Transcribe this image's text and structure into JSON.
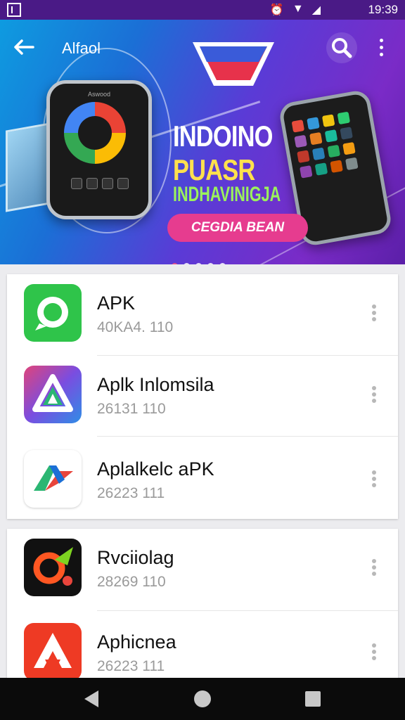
{
  "status_bar": {
    "time": "19:39"
  },
  "app_bar": {
    "title": "Alfaol"
  },
  "banner": {
    "phone_brand": "Aswood",
    "line1": "INDOINO",
    "line2": "PUASR",
    "line3": "INDHAVINIGJA",
    "cta": "CEGDIA BEAN",
    "page_count": 5,
    "active_page": 1
  },
  "colors": {
    "accent": "#e63c8f",
    "status_bar": "#4a1a86"
  },
  "apps_group1": [
    {
      "title": "APK",
      "subtitle": "40KA4. 110",
      "icon": "green-chat-icon"
    },
    {
      "title": "Aplk Inlomsila",
      "subtitle": "26131 110",
      "icon": "triangle-logo-icon"
    },
    {
      "title": "Aplalkelc aPK",
      "subtitle": "26223 111",
      "icon": "green-arrow-logo-icon"
    }
  ],
  "apps_group2": [
    {
      "title": "Rvciiolag",
      "subtitle": "28269 110",
      "icon": "orange-loop-icon"
    },
    {
      "title": "Aphicnea",
      "subtitle": "26223 111",
      "icon": "red-a-logo-icon"
    }
  ]
}
